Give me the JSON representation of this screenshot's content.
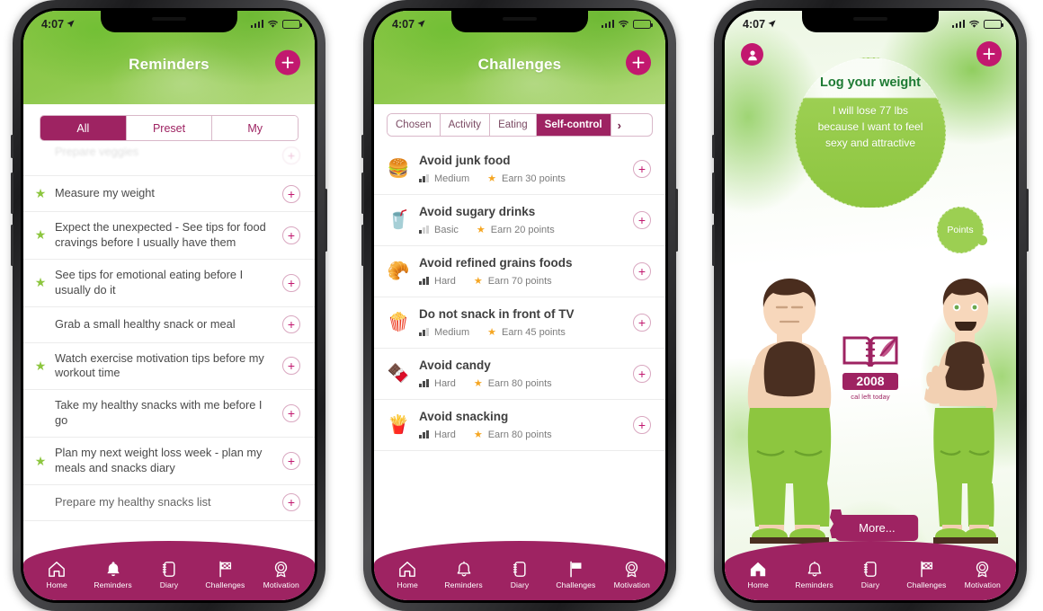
{
  "statusbar": {
    "time": "4:07",
    "location_icon": "location-arrow-icon",
    "signal_icon": "cellular-signal-icon",
    "wifi_icon": "wifi-icon",
    "battery_icon": "battery-icon"
  },
  "phone1": {
    "header": {
      "title": "Reminders",
      "add_button": "+"
    },
    "segments": [
      {
        "label": "All",
        "active": true
      },
      {
        "label": "Preset",
        "active": false
      },
      {
        "label": "My",
        "active": false
      }
    ],
    "reminders": [
      {
        "text": "Prepare veggies",
        "starred": false,
        "clipped": true
      },
      {
        "text": "Measure my weight",
        "starred": true
      },
      {
        "text": "Expect the unexpected - See tips for food cravings before I usually have them",
        "starred": true
      },
      {
        "text": "See tips for emotional eating before I usually do it",
        "starred": true
      },
      {
        "text": "Grab a small healthy snack or meal",
        "starred": false
      },
      {
        "text": "Watch exercise motivation tips before my workout time",
        "starred": true
      },
      {
        "text": "Take my healthy snacks with me before I go",
        "starred": false
      },
      {
        "text": "Plan my next weight loss week - plan my meals and snacks diary",
        "starred": true
      },
      {
        "text": "Prepare my healthy snacks list",
        "starred": false,
        "clipped": true
      }
    ],
    "nav": [
      {
        "label": "Home",
        "icon": "home-icon",
        "active": false
      },
      {
        "label": "Reminders",
        "icon": "bell-icon",
        "active": true
      },
      {
        "label": "Diary",
        "icon": "diary-icon",
        "active": false
      },
      {
        "label": "Challenges",
        "icon": "flag-icon",
        "active": false
      },
      {
        "label": "Motivation",
        "icon": "medal-icon",
        "active": false
      }
    ]
  },
  "phone2": {
    "header": {
      "title": "Challenges",
      "add_button": "+"
    },
    "tabs": [
      {
        "label": "Chosen",
        "active": false
      },
      {
        "label": "Activity",
        "active": false
      },
      {
        "label": "Eating",
        "active": false
      },
      {
        "label": "Self-control",
        "active": true
      }
    ],
    "tabs_more": "›",
    "challenges": [
      {
        "title": "Avoid junk food",
        "level": "Medium",
        "level_bars": 2,
        "points": "Earn 30 points",
        "emoji": "🍔",
        "icon": "burger-icon"
      },
      {
        "title": "Avoid sugary drinks",
        "level": "Basic",
        "level_bars": 1,
        "points": "Earn 20 points",
        "emoji": "🥤",
        "icon": "soda-icon"
      },
      {
        "title": "Avoid refined grains foods",
        "level": "Hard",
        "level_bars": 3,
        "points": "Earn 70 points",
        "emoji": "🥐",
        "icon": "croissant-icon"
      },
      {
        "title": "Do not snack in front of TV",
        "level": "Medium",
        "level_bars": 2,
        "points": "Earn 45 points",
        "emoji": "🍿",
        "icon": "popcorn-icon"
      },
      {
        "title": "Avoid candy",
        "level": "Hard",
        "level_bars": 3,
        "points": "Earn 80 points",
        "emoji": "🍫",
        "icon": "chocolate-icon"
      },
      {
        "title": "Avoid snacking",
        "level": "Hard",
        "level_bars": 3,
        "points": "Earn 80 points",
        "emoji": "🍟",
        "icon": "fries-icon"
      }
    ],
    "nav": [
      {
        "label": "Home",
        "icon": "home-icon",
        "active": false
      },
      {
        "label": "Reminders",
        "icon": "bell-icon",
        "active": false
      },
      {
        "label": "Diary",
        "icon": "diary-icon",
        "active": false
      },
      {
        "label": "Challenges",
        "icon": "flag-icon",
        "active": true
      },
      {
        "label": "Motivation",
        "icon": "medal-icon",
        "active": false
      }
    ]
  },
  "phone3": {
    "avatar_button": "profile-avatar-icon",
    "add_button": "+",
    "bubble": {
      "title": "Log your weight",
      "text": "I will lose 77 lbs because I want to feel sexy and attractive"
    },
    "points_bubble": "Points",
    "diary_badge": {
      "value": "2008",
      "caption": "cal left today",
      "icon": "diary-feather-icon"
    },
    "more_button": "More...",
    "torso_icon": "body-measure-icon",
    "characters": [
      {
        "name": "avatar-before",
        "state": "heavier"
      },
      {
        "name": "avatar-after",
        "state": "slimmer"
      }
    ],
    "nav": [
      {
        "label": "Home",
        "icon": "home-icon",
        "active": true
      },
      {
        "label": "Reminders",
        "icon": "bell-icon",
        "active": false
      },
      {
        "label": "Diary",
        "icon": "diary-icon",
        "active": false
      },
      {
        "label": "Challenges",
        "icon": "flag-icon",
        "active": false
      },
      {
        "label": "Motivation",
        "icon": "medal-icon",
        "active": false
      }
    ]
  },
  "colors": {
    "brand_magenta": "#9e2362",
    "accent_pink": "#c2186f",
    "brand_green": "#8dc53f",
    "header_green_dark": "#86c442",
    "header_green_light": "#b2d97c",
    "star_green": "#8dc63f",
    "star_orange": "#f5a623",
    "text_gray": "#4a4a4a",
    "bubble_title_green": "#1d7a33"
  }
}
